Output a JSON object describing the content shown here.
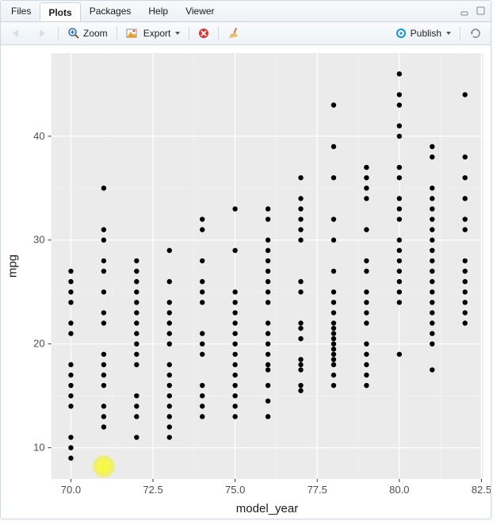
{
  "tabs": {
    "files": {
      "label": "Files"
    },
    "plots": {
      "label": "Plots"
    },
    "packages": {
      "label": "Packages"
    },
    "help": {
      "label": "Help"
    },
    "viewer": {
      "label": "Viewer"
    },
    "active": "plots"
  },
  "toolbar": {
    "zoom_label": "Zoom",
    "export_label": "Export",
    "publish_label": "Publish"
  },
  "chart_data": {
    "type": "scatter",
    "title": "",
    "xlabel": "model_year",
    "ylabel": "mpg",
    "xlim": [
      69.4,
      82.55
    ],
    "ylim": [
      7,
      48
    ],
    "x_ticks": [
      70.0,
      72.5,
      75.0,
      77.5,
      80.0,
      82.5
    ],
    "y_ticks": [
      10,
      20,
      30,
      40
    ],
    "series": [
      {
        "name": "points",
        "points": [
          [
            70,
            18
          ],
          [
            70,
            15
          ],
          [
            70,
            16
          ],
          [
            70,
            17
          ],
          [
            70,
            14
          ],
          [
            70,
            24
          ],
          [
            70,
            22
          ],
          [
            70,
            21
          ],
          [
            70,
            27
          ],
          [
            70,
            26
          ],
          [
            70,
            25
          ],
          [
            70,
            10
          ],
          [
            70,
            11
          ],
          [
            70,
            9
          ],
          [
            71,
            27
          ],
          [
            71,
            28
          ],
          [
            71,
            25
          ],
          [
            71,
            19
          ],
          [
            71,
            16
          ],
          [
            71,
            17
          ],
          [
            71,
            18
          ],
          [
            71,
            14
          ],
          [
            71,
            12
          ],
          [
            71,
            13
          ],
          [
            71,
            23
          ],
          [
            71,
            30
          ],
          [
            71,
            31
          ],
          [
            71,
            35
          ],
          [
            71,
            22
          ],
          [
            72,
            13
          ],
          [
            72,
            14
          ],
          [
            72,
            15
          ],
          [
            72,
            18
          ],
          [
            72,
            22
          ],
          [
            72,
            21
          ],
          [
            72,
            28
          ],
          [
            72,
            27
          ],
          [
            72,
            11
          ],
          [
            72,
            23
          ],
          [
            72,
            24
          ],
          [
            72,
            25
          ],
          [
            72,
            26
          ],
          [
            72,
            20
          ],
          [
            72,
            19
          ],
          [
            73,
            13
          ],
          [
            73,
            14
          ],
          [
            73,
            15
          ],
          [
            73,
            12
          ],
          [
            73,
            11
          ],
          [
            73,
            16
          ],
          [
            73,
            18
          ],
          [
            73,
            22
          ],
          [
            73,
            21
          ],
          [
            73,
            26
          ],
          [
            73,
            20
          ],
          [
            73,
            23
          ],
          [
            73,
            24
          ],
          [
            73,
            29
          ],
          [
            73,
            17
          ],
          [
            74,
            16
          ],
          [
            74,
            26
          ],
          [
            74,
            24
          ],
          [
            74,
            25
          ],
          [
            74,
            31
          ],
          [
            74,
            32
          ],
          [
            74,
            28
          ],
          [
            74,
            13
          ],
          [
            74,
            14
          ],
          [
            74,
            19
          ],
          [
            74,
            20
          ],
          [
            74,
            21
          ],
          [
            74,
            15
          ],
          [
            75,
            18
          ],
          [
            75,
            15
          ],
          [
            75,
            16
          ],
          [
            75,
            19
          ],
          [
            75,
            21
          ],
          [
            75,
            25
          ],
          [
            75,
            24
          ],
          [
            75,
            22
          ],
          [
            75,
            29
          ],
          [
            75,
            23
          ],
          [
            75,
            20
          ],
          [
            75,
            13
          ],
          [
            75,
            33
          ],
          [
            75,
            14
          ],
          [
            75,
            17
          ],
          [
            76,
            28
          ],
          [
            76,
            29
          ],
          [
            76,
            33
          ],
          [
            76,
            30
          ],
          [
            76,
            32
          ],
          [
            76,
            26
          ],
          [
            76,
            24
          ],
          [
            76,
            22
          ],
          [
            76,
            20
          ],
          [
            76,
            21
          ],
          [
            76,
            13
          ],
          [
            76,
            18
          ],
          [
            76,
            16
          ],
          [
            76,
            17.5
          ],
          [
            76,
            19
          ],
          [
            76,
            14.5
          ],
          [
            76,
            27
          ],
          [
            76,
            25
          ],
          [
            77,
            33
          ],
          [
            77,
            36
          ],
          [
            77,
            30
          ],
          [
            77,
            31
          ],
          [
            77,
            26
          ],
          [
            77,
            25
          ],
          [
            77,
            22
          ],
          [
            77,
            21.5
          ],
          [
            77,
            20.5
          ],
          [
            77,
            18
          ],
          [
            77,
            18.5
          ],
          [
            77,
            17.5
          ],
          [
            77,
            15.5
          ],
          [
            77,
            16
          ],
          [
            77,
            32
          ],
          [
            77,
            34
          ],
          [
            78,
            36
          ],
          [
            78,
            30
          ],
          [
            78,
            27
          ],
          [
            78,
            32
          ],
          [
            78,
            21
          ],
          [
            78,
            22
          ],
          [
            78,
            23
          ],
          [
            78,
            24
          ],
          [
            78,
            25
          ],
          [
            78,
            19
          ],
          [
            78,
            20
          ],
          [
            78,
            20.5
          ],
          [
            78,
            18
          ],
          [
            78,
            18.5
          ],
          [
            78,
            17
          ],
          [
            78,
            16
          ],
          [
            78,
            19.5
          ],
          [
            78,
            21.5
          ],
          [
            78,
            43
          ],
          [
            78,
            39
          ],
          [
            79,
            27
          ],
          [
            79,
            28
          ],
          [
            79,
            23
          ],
          [
            79,
            22
          ],
          [
            79,
            24
          ],
          [
            79,
            25
          ],
          [
            79,
            16
          ],
          [
            79,
            17
          ],
          [
            79,
            18
          ],
          [
            79,
            19
          ],
          [
            79,
            20
          ],
          [
            79,
            31
          ],
          [
            79,
            34
          ],
          [
            79,
            35
          ],
          [
            79,
            36
          ],
          [
            79,
            37
          ],
          [
            80,
            40
          ],
          [
            80,
            41
          ],
          [
            80,
            43
          ],
          [
            80,
            44
          ],
          [
            80,
            46
          ],
          [
            80,
            36
          ],
          [
            80,
            37
          ],
          [
            80,
            33
          ],
          [
            80,
            34
          ],
          [
            80,
            32
          ],
          [
            80,
            30
          ],
          [
            80,
            28
          ],
          [
            80,
            27
          ],
          [
            80,
            26
          ],
          [
            80,
            25
          ],
          [
            80,
            24
          ],
          [
            80,
            19
          ],
          [
            80,
            29
          ],
          [
            81,
            35
          ],
          [
            81,
            34
          ],
          [
            81,
            33
          ],
          [
            81,
            32
          ],
          [
            81,
            31
          ],
          [
            81,
            30
          ],
          [
            81,
            29
          ],
          [
            81,
            28
          ],
          [
            81,
            27
          ],
          [
            81,
            26
          ],
          [
            81,
            25
          ],
          [
            81,
            24
          ],
          [
            81,
            23
          ],
          [
            81,
            22
          ],
          [
            81,
            21
          ],
          [
            81,
            20
          ],
          [
            81,
            38
          ],
          [
            81,
            39
          ],
          [
            81,
            17.5
          ],
          [
            82,
            44
          ],
          [
            82,
            36
          ],
          [
            82,
            34
          ],
          [
            82,
            32
          ],
          [
            82,
            31
          ],
          [
            82,
            28
          ],
          [
            82,
            27
          ],
          [
            82,
            26
          ],
          [
            82,
            25
          ],
          [
            82,
            24
          ],
          [
            82,
            23
          ],
          [
            82,
            22
          ],
          [
            82,
            38
          ]
        ]
      }
    ],
    "highlight_cursor": {
      "x": 71,
      "y": 8.2
    }
  }
}
